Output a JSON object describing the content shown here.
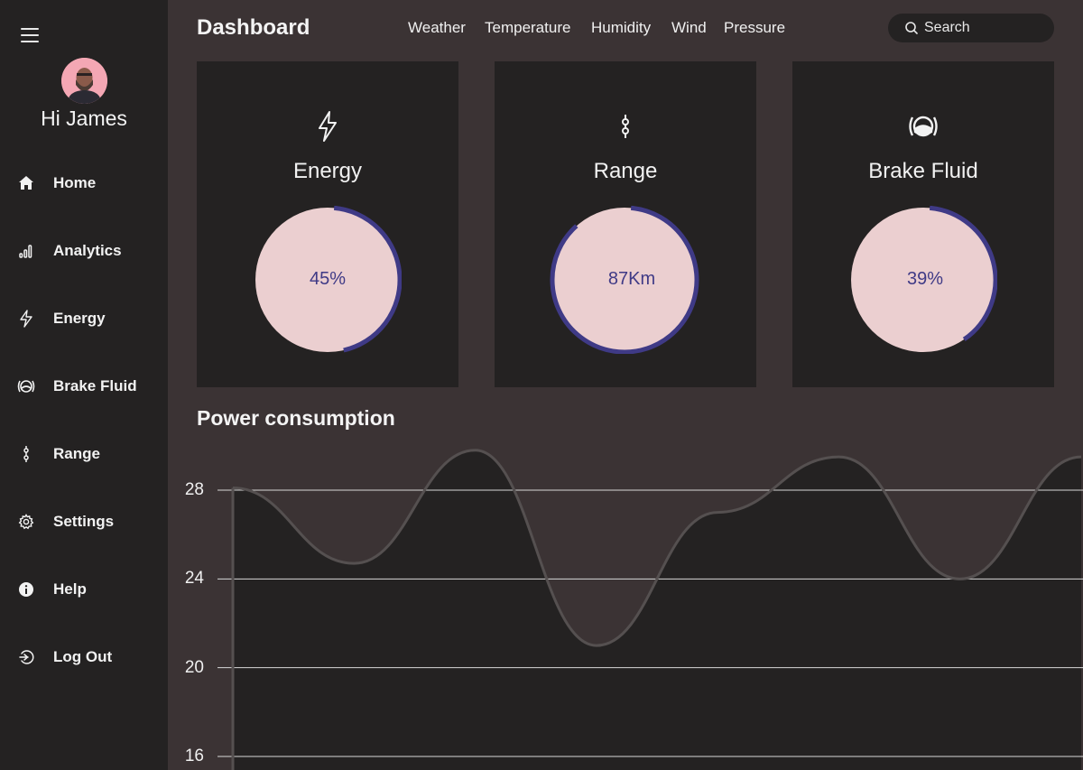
{
  "sidebar": {
    "greeting": "Hi James",
    "items": [
      {
        "label": "Home",
        "icon": "home-icon"
      },
      {
        "label": "Analytics",
        "icon": "bar-chart-icon"
      },
      {
        "label": "Energy",
        "icon": "lightning-icon"
      },
      {
        "label": "Brake Fluid",
        "icon": "brake-fluid-icon"
      },
      {
        "label": "Range",
        "icon": "route-icon"
      },
      {
        "label": "Settings",
        "icon": "gear-icon"
      },
      {
        "label": "Help",
        "icon": "info-icon"
      },
      {
        "label": "Log Out",
        "icon": "logout-icon"
      }
    ]
  },
  "header": {
    "title": "Dashboard",
    "nav": [
      "Weather",
      "Temperature",
      "Humidity",
      "Wind",
      "Pressure"
    ],
    "search_placeholder": "Search"
  },
  "cards": [
    {
      "title": "Energy",
      "value": "45%",
      "progress": 0.45,
      "icon": "lightning-icon"
    },
    {
      "title": "Range",
      "value": "87Km",
      "progress": 0.87,
      "icon": "route-icon"
    },
    {
      "title": "Brake Fluid",
      "value": "39%",
      "progress": 0.39,
      "icon": "brake-fluid-icon"
    }
  ],
  "colors": {
    "accent": "#3f3a86",
    "gauge_fill": "#ebcfd0",
    "panel": "#242222",
    "background": "#3b3334"
  },
  "chart_data": {
    "type": "area",
    "title": "Power consumption",
    "xlabel": "",
    "ylabel": "",
    "ylim": [
      16,
      30
    ],
    "yticks": [
      28,
      24,
      20,
      16
    ],
    "grid": true,
    "x": [
      0,
      1,
      2,
      3,
      4,
      5,
      6,
      7
    ],
    "series": [
      {
        "values": [
          28.1,
          24.7,
          29.8,
          21.0,
          27.0,
          29.5,
          24.0,
          29.5
        ]
      }
    ]
  }
}
